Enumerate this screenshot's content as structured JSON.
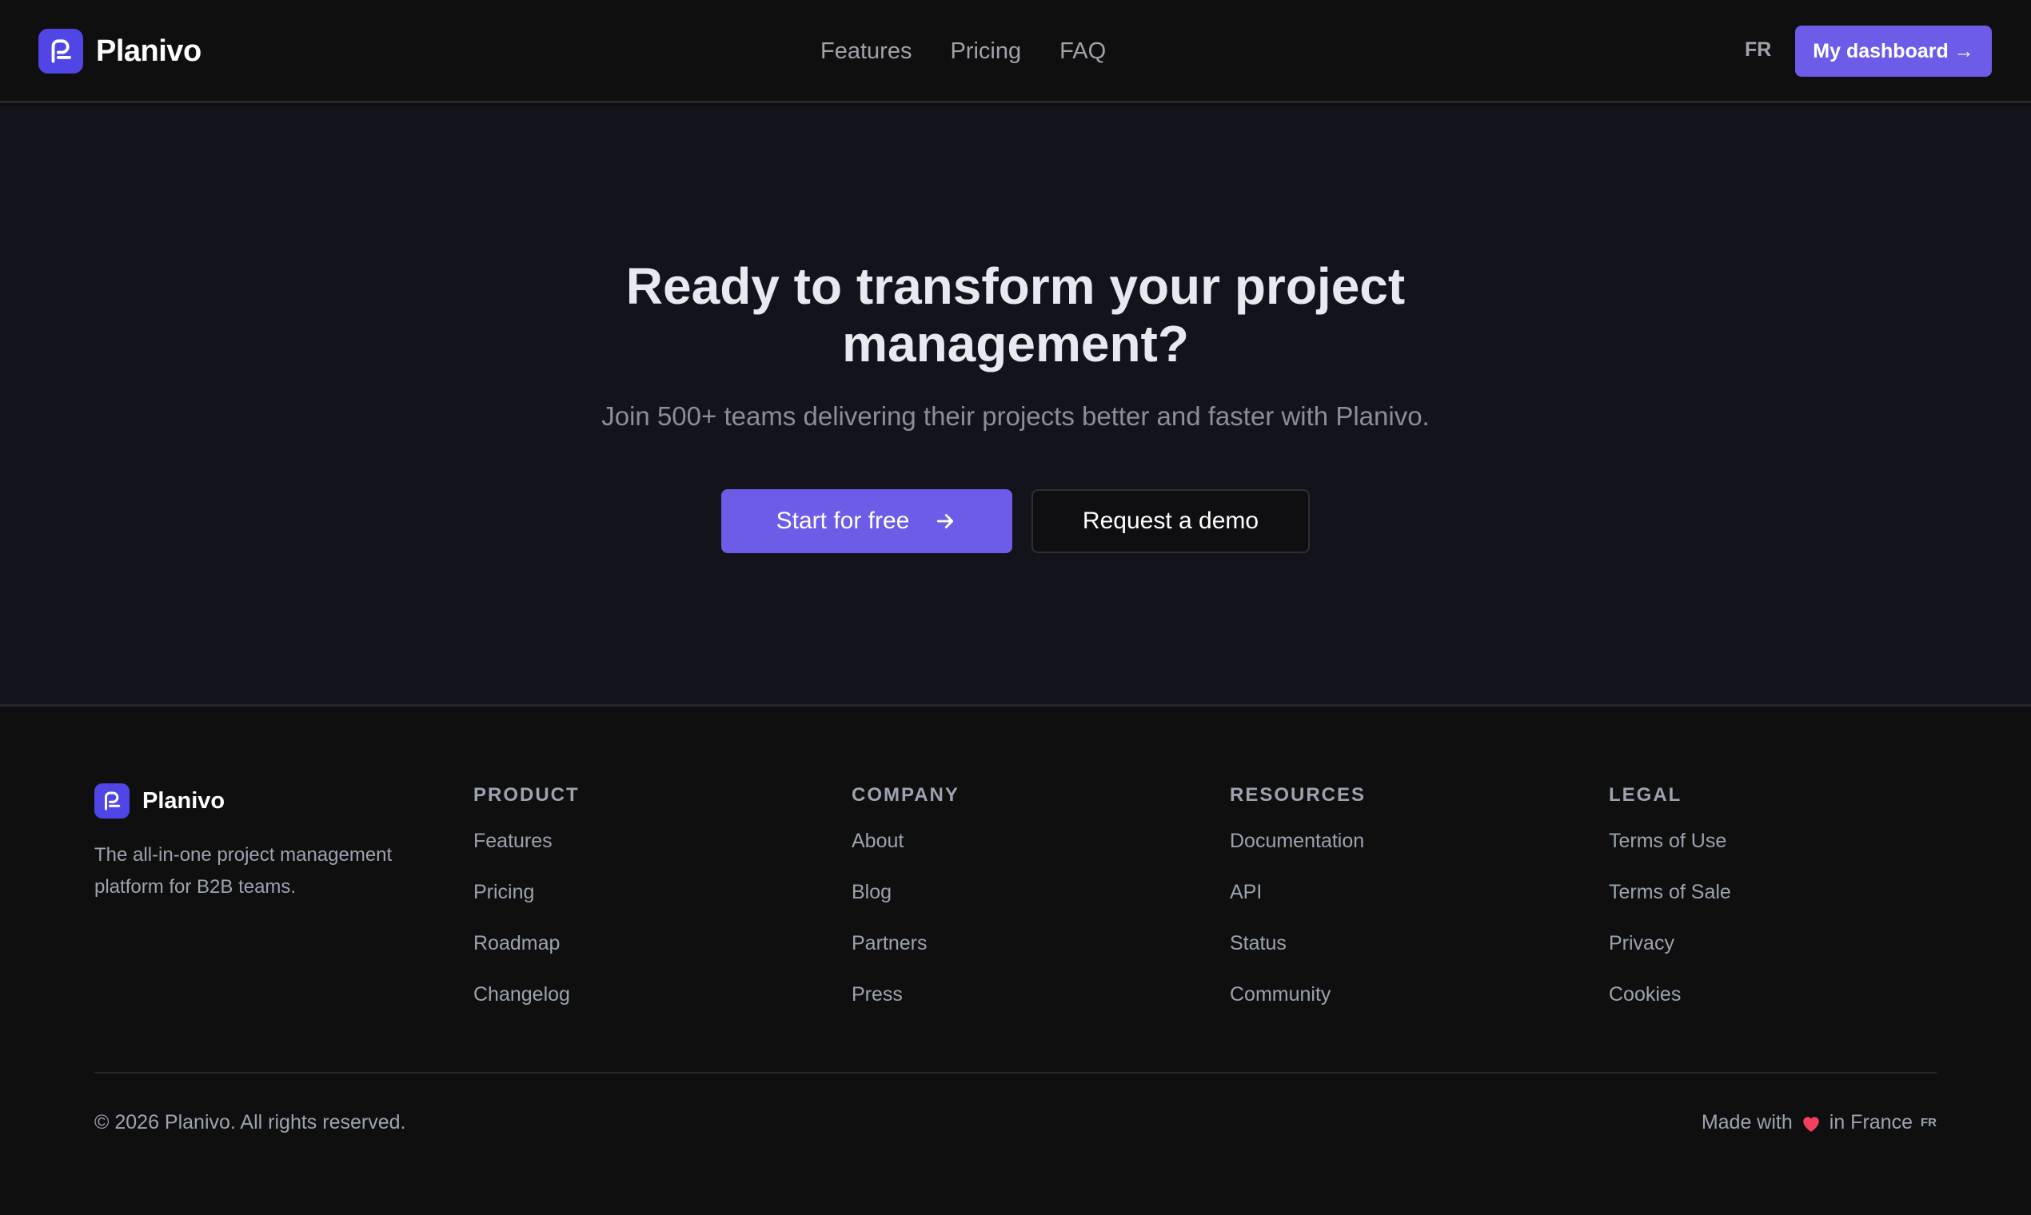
{
  "header": {
    "brand": "Planivo",
    "nav": [
      "Features",
      "Pricing",
      "FAQ"
    ],
    "lang": "FR",
    "dashboard_label": "My dashboard →"
  },
  "hero": {
    "title_line1": "Ready to transform your project",
    "title_line2": "management?",
    "subtitle": "Join 500+ teams delivering their projects better and faster with Planivo.",
    "primary_label": "Start for free",
    "secondary_label": "Request a demo"
  },
  "footer": {
    "brand": "Planivo",
    "tagline": "The all-in-one project management platform for B2B teams.",
    "columns": [
      {
        "title": "PRODUCT",
        "links": [
          "Features",
          "Pricing",
          "Roadmap",
          "Changelog"
        ]
      },
      {
        "title": "COMPANY",
        "links": [
          "About",
          "Blog",
          "Partners",
          "Press"
        ]
      },
      {
        "title": "RESOURCES",
        "links": [
          "Documentation",
          "API",
          "Status",
          "Community"
        ]
      },
      {
        "title": "LEGAL",
        "links": [
          "Terms of Use",
          "Terms of Sale",
          "Privacy",
          "Cookies"
        ]
      }
    ],
    "copyright": "© 2026 Planivo. All rights reserved.",
    "made_with_prefix": "Made with",
    "made_with_suffix": "in France",
    "country_code": "FR"
  },
  "colors": {
    "accent": "#6c5ce7",
    "logo": "#4f46e5",
    "heart": "#f43f5e"
  }
}
